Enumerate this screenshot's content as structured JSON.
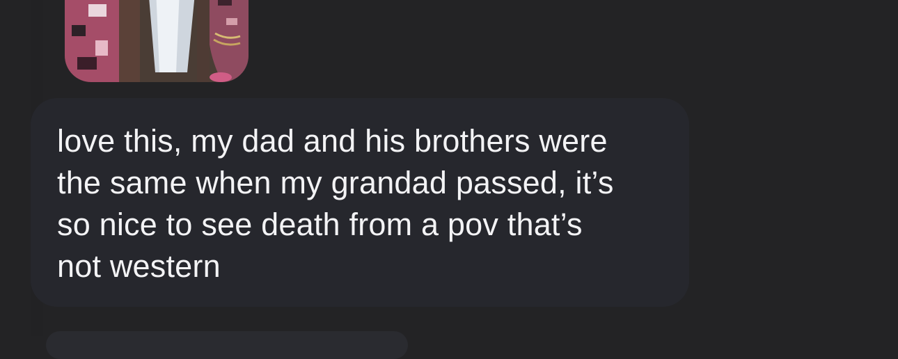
{
  "conversation": {
    "incoming_message": {
      "text": "love this, my dad and his brothers were\nthe same when my grandad passed, it’s\nso nice to see death from a pov that’s\nnot western"
    },
    "attachment": {
      "type": "image"
    }
  },
  "colors": {
    "background": "#232325",
    "bubble": "#26272d",
    "text": "#f3f3f5"
  }
}
